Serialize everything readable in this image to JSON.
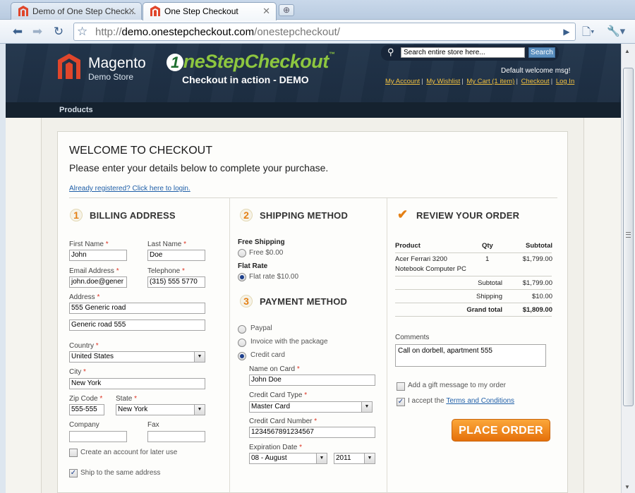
{
  "browser": {
    "tabs": [
      {
        "label": "Demo of One Step Check..."
      },
      {
        "label": "One Step Checkout"
      }
    ],
    "url_host": "demo.onestepcheckout.com",
    "url_path": "/onestepcheckout/",
    "url_scheme": "http://"
  },
  "header": {
    "store_name": "Magento",
    "store_sub": "Demo Store",
    "osc_one": "1",
    "osc_rest": "neStepCheckout",
    "osc_tm": "™",
    "osc_tagline": "Checkout in action - DEMO",
    "search_placeholder": "Search entire store here...",
    "search_button": "Search",
    "welcome": "Default welcome msg!",
    "links": [
      "My Account",
      "My Wishlist",
      "My Cart (1 item)",
      "Checkout",
      "Log In"
    ],
    "nav_products": "Products"
  },
  "checkout": {
    "title": "WELCOME TO CHECKOUT",
    "subtitle": "Please enter your details below to complete your purchase.",
    "login_link": "Already registered? Click here to login.",
    "billing": {
      "step": "1",
      "title": "BILLING ADDRESS",
      "first_name_label": "First Name",
      "first_name": "John",
      "last_name_label": "Last Name",
      "last_name": "Doe",
      "email_label": "Email Address",
      "email": "john.doe@gener",
      "telephone_label": "Telephone",
      "telephone": "(315) 555 5770",
      "address_label": "Address",
      "address1": "555 Generic road",
      "address2": "Generic road 555",
      "country_label": "Country",
      "country": "United States",
      "city_label": "City",
      "city": "New York",
      "zip_label": "Zip Code",
      "zip": "555-555",
      "state_label": "State",
      "state": "New York",
      "company_label": "Company",
      "fax_label": "Fax",
      "create_account": "Create an account for later use",
      "ship_same": "Ship to the same address",
      "req": "*"
    },
    "shipping": {
      "step": "2",
      "title": "SHIPPING METHOD",
      "free_heading": "Free Shipping",
      "free_option": "Free $0.00",
      "flat_heading": "Flat Rate",
      "flat_option": "Flat rate $10.00"
    },
    "payment": {
      "step": "3",
      "title": "PAYMENT METHOD",
      "options": [
        "Paypal",
        "Invoice with the package",
        "Credit card"
      ],
      "name_label": "Name on Card",
      "name": "John Doe",
      "type_label": "Credit Card Type",
      "type": "Master Card",
      "number_label": "Credit Card Number",
      "number": "1234567891234567",
      "exp_label": "Expiration Date",
      "exp_month": "08 - August",
      "exp_year": "2011"
    },
    "review": {
      "title": "REVIEW YOUR ORDER",
      "col_product": "Product",
      "col_qty": "Qty",
      "col_subtotal": "Subtotal",
      "product_line1": "Acer Ferrari 3200",
      "product_line2": "Notebook Computer PC",
      "qty": "1",
      "line_subtotal": "$1,799.00",
      "subtotal_label": "Subtotal",
      "subtotal": "$1,799.00",
      "shipping_label": "Shipping",
      "shipping": "$10.00",
      "grand_label": "Grand total",
      "grand": "$1,809.00",
      "comments_label": "Comments",
      "comments": "Call on dorbell, apartment 555",
      "gift": "Add a gift message to my order",
      "accept": "I accept the",
      "terms": "Terms and Conditions",
      "place_order": "PLACE ORDER"
    }
  },
  "colors": {
    "accent_orange": "#e5700a",
    "link_blue": "#1f5fa8",
    "header_navy": "#1c2c40",
    "osc_green": "#8dc63f"
  }
}
